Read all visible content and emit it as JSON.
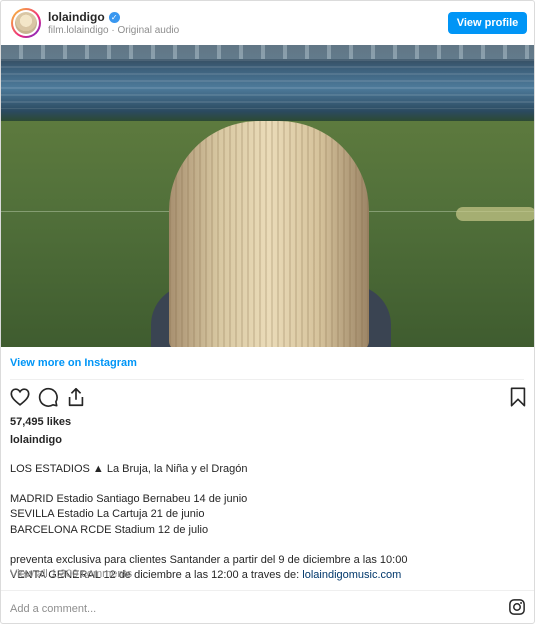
{
  "header": {
    "username": "lolaindigo",
    "subline": "film.lolaindigo · Original audio",
    "view_profile_label": "View profile"
  },
  "view_more": "View more on Instagram",
  "likes": "57,495 likes",
  "owner": "lolaindigo",
  "caption": {
    "line1": "LOS ESTADIOS ▲ La Bruja, la Niña y el Dragón",
    "line2": "MADRID Estadio Santiago Bernabeu 14 de junio",
    "line3": "SEVILLA Estadio La Cartuja 21 de junio",
    "line4": "BARCELONA RCDE Stadium 12 de julio",
    "line5": "preventa exclusiva para clientes Santander a partir del 9 de diciembre a las 10:00",
    "line6_prefix": "VENTA GENERAL 12 de diciembre a las 12:00 a traves de: ",
    "line6_link": "lolaindigomusic.com"
  },
  "view_comments": "View all 1,300 comments",
  "add_comment_placeholder": "Add a comment...",
  "icons": {
    "like": "heart-icon",
    "comment": "comment-icon",
    "share": "share-icon",
    "save": "bookmark-icon",
    "instagram": "instagram-icon",
    "verified": "verified-badge-icon"
  },
  "colors": {
    "accent": "#0095f6",
    "link": "#00376b",
    "muted": "#8e8e8e",
    "text": "#262626"
  }
}
